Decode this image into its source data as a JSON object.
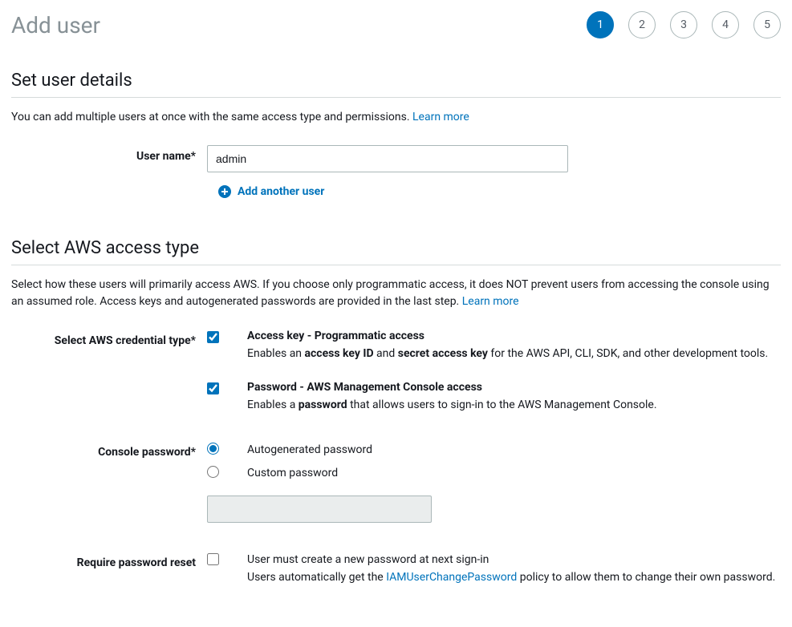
{
  "header": {
    "title": "Add user",
    "steps": [
      "1",
      "2",
      "3",
      "4",
      "5"
    ],
    "activeStep": 0
  },
  "section1": {
    "title": "Set user details",
    "subtitle_pre": "You can add multiple users at once with the same access type and permissions. ",
    "learn_more": "Learn more",
    "username_label": "User name*",
    "username_value": "admin",
    "add_another": "Add another user"
  },
  "section2": {
    "title": "Select AWS access type",
    "subtitle_pre": "Select how these users will primarily access AWS. If you choose only programmatic access, it does NOT prevent users from accessing the console using an assumed role. Access keys and autogenerated passwords are provided in the last step. ",
    "learn_more": "Learn more",
    "credential_label": "Select AWS credential type*",
    "opt1": {
      "checked": true,
      "title": "Access key - Programmatic access",
      "desc_pre": "Enables an ",
      "desc_bold1": "access key ID",
      "desc_mid": " and ",
      "desc_bold2": "secret access key",
      "desc_post": " for the AWS API, CLI, SDK, and other development tools."
    },
    "opt2": {
      "checked": true,
      "title": "Password - AWS Management Console access",
      "desc_pre": "Enables a ",
      "desc_bold1": "password",
      "desc_post": " that allows users to sign-in to the AWS Management Console."
    },
    "console_pw_label": "Console password*",
    "pw_auto": "Autogenerated password",
    "pw_custom": "Custom password",
    "pw_selected": "auto",
    "reset_label": "Require password reset",
    "reset_checked": false,
    "reset_line1": "User must create a new password at next sign-in",
    "reset_line2_pre": "Users automatically get the ",
    "reset_link": "IAMUserChangePassword",
    "reset_line2_post": " policy to allow them to change their own password."
  }
}
